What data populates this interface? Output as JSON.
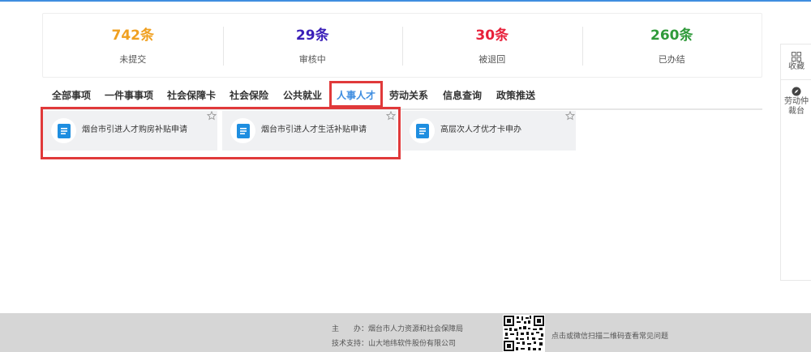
{
  "stats": [
    {
      "value": "742条",
      "label": "未提交",
      "color": "#f0a020"
    },
    {
      "value": "29条",
      "label": "审核中",
      "color": "#3a1fb8"
    },
    {
      "value": "30条",
      "label": "被退回",
      "color": "#e8203a"
    },
    {
      "value": "260条",
      "label": "已办结",
      "color": "#2f9a3a"
    }
  ],
  "tabs": [
    {
      "label": "全部事项"
    },
    {
      "label": "一件事事项"
    },
    {
      "label": "社会保障卡"
    },
    {
      "label": "社会保险"
    },
    {
      "label": "公共就业"
    },
    {
      "label": "人事人才",
      "active": true
    },
    {
      "label": "劳动关系"
    },
    {
      "label": "信息查询"
    },
    {
      "label": "政策推送"
    }
  ],
  "cards": [
    {
      "title": "烟台市引进人才购房补贴申请",
      "icon": "document-icon"
    },
    {
      "title": "烟台市引进人才生活补贴申请",
      "icon": "document-icon"
    },
    {
      "title": "高层次人才优才卡申办",
      "icon": "document-icon"
    }
  ],
  "sidebar": [
    {
      "label": "收藏",
      "icon": "grid-icon"
    },
    {
      "label": "劳动仲裁台",
      "icon": "compass-icon"
    }
  ],
  "footer": {
    "host_label": "主　　办：",
    "host_value": "烟台市人力资源和社会保障局",
    "support_label": "技术支持：",
    "support_value": "山大地纬软件股份有限公司",
    "qr_hint": "点击或微信扫描二维码查看常见问题"
  },
  "accent": "#3e8de0",
  "highlight": "#e0393a"
}
